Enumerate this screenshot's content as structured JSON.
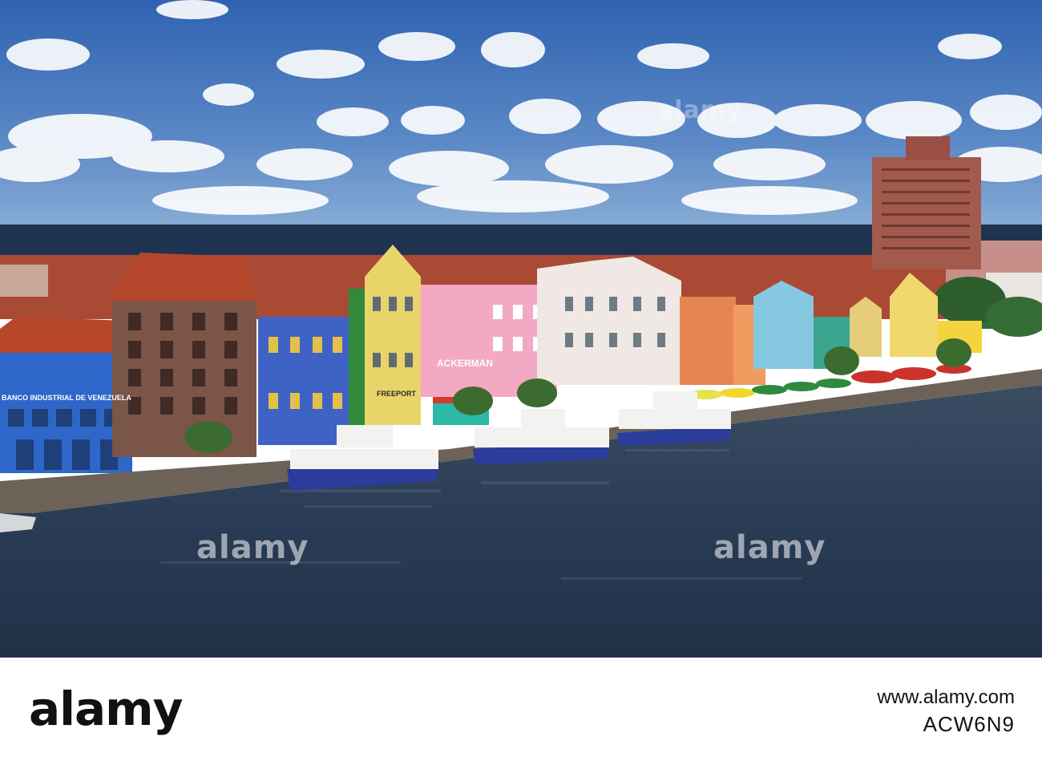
{
  "photo": {
    "signs": {
      "bank": "BANCO INDUSTRIAL DE VENEZUELA",
      "freeport": "FREEPORT",
      "ackerman": "ACKERMAN"
    },
    "watermarks": [
      "alamy",
      "alamy",
      "alamy"
    ]
  },
  "footer": {
    "logo": "alamy",
    "site": "www.alamy.com",
    "image_id": "ACW6N9"
  },
  "colors": {
    "sky": "#3d6fb8",
    "sea": "#1e3147",
    "water": "#2c3e55",
    "roofs": "#b8462b"
  }
}
